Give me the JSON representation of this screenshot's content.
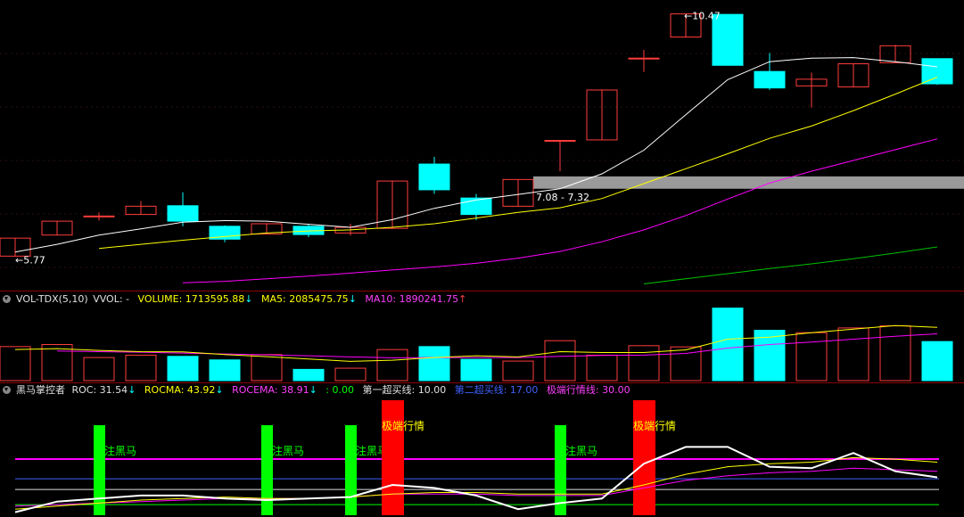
{
  "main_chart": {
    "high_label": "10.47",
    "low_label": "5.77",
    "price_band_label": "7.08 - 7.32"
  },
  "volume_header": {
    "indicator": "VOL-TDX(5,10)",
    "vol_text": "VVOL: -",
    "volume_label": "VOLUME: 1713595.88",
    "volume_arrow": "↓",
    "ma5_label": "MA5: 2085475.75",
    "ma5_arrow": "↓",
    "ma10_label": "MA10: 1890241.75",
    "ma10_arrow": "↑"
  },
  "indicator_header": {
    "name": "黑马掌控者",
    "roc_label": "ROC: 31.54",
    "roc_arrow": "↓",
    "rocma_label": "ROCMA: 43.92",
    "rocma_arrow": "↓",
    "rocema_label": "ROCEMA: 38.91",
    "rocema_arrow": "↓",
    "zero_label": ": 0.00",
    "line1_label": "第一超买线: 10.00",
    "line2_label": "第二超买线: 17.00",
    "line3_label": "极端行情线: 30.00"
  },
  "annotations": {
    "watch_dark_horse": "关注黑马",
    "extreme_market": "极端行情"
  },
  "colors": {
    "up": "#ff3c3c",
    "down": "#00ffff",
    "ma_white": "#ffffff",
    "ma_yellow": "#ffff00",
    "ma_magenta": "#ff00ff",
    "ma_green": "#00c000",
    "signal_green": "#00ff00",
    "signal_red": "#ff0000"
  },
  "chart_data": {
    "type": "candlestick",
    "candles": [
      {
        "o": 5.77,
        "h": 6.12,
        "l": 5.77,
        "c": 6.12
      },
      {
        "o": 6.18,
        "h": 6.45,
        "l": 6.18,
        "c": 6.45
      },
      {
        "o": 6.55,
        "h": 6.62,
        "l": 6.46,
        "c": 6.55
      },
      {
        "o": 6.58,
        "h": 6.84,
        "l": 6.58,
        "c": 6.74
      },
      {
        "o": 6.75,
        "h": 7.01,
        "l": 6.35,
        "c": 6.45
      },
      {
        "o": 6.35,
        "h": 6.37,
        "l": 6.04,
        "c": 6.1
      },
      {
        "o": 6.2,
        "h": 6.41,
        "l": 6.2,
        "c": 6.4
      },
      {
        "o": 6.35,
        "h": 6.4,
        "l": 6.14,
        "c": 6.19
      },
      {
        "o": 6.22,
        "h": 6.4,
        "l": 6.17,
        "c": 6.33
      },
      {
        "o": 6.31,
        "h": 7.23,
        "l": 6.31,
        "c": 7.23
      },
      {
        "o": 7.56,
        "h": 7.7,
        "l": 6.98,
        "c": 7.06
      },
      {
        "o": 6.9,
        "h": 6.98,
        "l": 6.47,
        "c": 6.58
      },
      {
        "o": 6.74,
        "h": 7.26,
        "l": 6.74,
        "c": 7.26
      },
      {
        "o": 8.02,
        "h": 8.02,
        "l": 7.42,
        "c": 8.02
      },
      {
        "o": 8.03,
        "h": 9.0,
        "l": 8.03,
        "c": 9.0
      },
      {
        "o": 9.62,
        "h": 9.78,
        "l": 9.35,
        "c": 9.62
      },
      {
        "o": 10.03,
        "h": 10.48,
        "l": 10.03,
        "c": 10.48
      },
      {
        "o": 10.47,
        "h": 10.47,
        "l": 9.48,
        "c": 9.48
      },
      {
        "o": 9.36,
        "h": 9.72,
        "l": 9.0,
        "c": 9.04
      },
      {
        "o": 9.08,
        "h": 9.34,
        "l": 8.66,
        "c": 9.21
      },
      {
        "o": 9.06,
        "h": 9.51,
        "l": 9.06,
        "c": 9.51
      },
      {
        "o": 9.53,
        "h": 9.88,
        "l": 9.53,
        "c": 9.86
      },
      {
        "o": 9.61,
        "h": 9.61,
        "l": 9.1,
        "c": 9.12
      }
    ],
    "ma_white": [
      5.85,
      6.0,
      6.18,
      6.3,
      6.43,
      6.46,
      6.45,
      6.39,
      6.33,
      6.48,
      6.7,
      6.86,
      6.97,
      7.08,
      7.37,
      7.83,
      8.52,
      9.2,
      9.55,
      9.62,
      9.63,
      9.55,
      9.45
    ],
    "ma_yellow": [
      null,
      null,
      5.92,
      6.0,
      6.08,
      6.15,
      6.22,
      6.26,
      6.28,
      6.33,
      6.4,
      6.51,
      6.62,
      6.71,
      6.89,
      7.18,
      7.47,
      7.76,
      8.06,
      8.3,
      8.6,
      8.92,
      9.25
    ],
    "ma_magenta": [
      null,
      null,
      null,
      null,
      5.25,
      5.28,
      5.33,
      5.38,
      5.44,
      5.5,
      5.56,
      5.63,
      5.73,
      5.86,
      6.05,
      6.28,
      6.56,
      6.88,
      7.19,
      7.42,
      7.63,
      7.84,
      8.05
    ],
    "ma_green": [
      null,
      null,
      null,
      null,
      null,
      null,
      null,
      null,
      null,
      null,
      null,
      null,
      null,
      null,
      null,
      5.23,
      5.33,
      5.43,
      5.53,
      5.62,
      5.72,
      5.83,
      5.95
    ],
    "volumes": [
      1.15,
      1.22,
      0.78,
      0.86,
      0.82,
      0.7,
      0.88,
      0.38,
      0.42,
      1.05,
      1.15,
      0.72,
      0.66,
      1.35,
      0.86,
      1.18,
      1.14,
      2.45,
      1.7,
      1.62,
      1.78,
      1.85,
      1.32
    ],
    "vol_ma5": [
      1.05,
      1.08,
      1.02,
      0.98,
      0.97,
      0.88,
      0.81,
      0.73,
      0.65,
      0.69,
      0.78,
      0.84,
      0.8,
      0.98,
      0.95,
      0.95,
      1.04,
      1.4,
      1.47,
      1.62,
      1.74,
      1.86,
      1.8
    ],
    "vol_ma10": [
      null,
      1.0,
      0.98,
      0.96,
      0.93,
      0.9,
      0.87,
      0.84,
      0.8,
      0.77,
      0.78,
      0.78,
      0.78,
      0.82,
      0.85,
      0.86,
      0.92,
      1.1,
      1.22,
      1.3,
      1.4,
      1.5,
      1.58
    ],
    "roc": [
      -5,
      2,
      4,
      6,
      6,
      4,
      3,
      4,
      5,
      13,
      11,
      6,
      -3,
      1,
      4,
      27,
      38,
      38,
      25,
      24,
      34,
      22,
      18
    ],
    "rocma": [
      -3,
      -1,
      1,
      3,
      4,
      5,
      4,
      4,
      5,
      7,
      8,
      8,
      7,
      7,
      7,
      13,
      20,
      25,
      27,
      28,
      31,
      30,
      28
    ],
    "rocema": [
      -1,
      0,
      1,
      2,
      3,
      4,
      4,
      4,
      5,
      7,
      7,
      7,
      6,
      6,
      6,
      11,
      16,
      19,
      21,
      22,
      24,
      23,
      22
    ],
    "overbought_lines": [
      0,
      10,
      17,
      30
    ],
    "green_signal_bars": [
      2,
      6,
      8,
      13
    ],
    "red_signal_bars": [
      9,
      15
    ],
    "main_ylim": [
      5.1,
      10.75
    ],
    "vol_ylim": [
      0,
      2.5
    ],
    "ind_ylim": [
      -7,
      70
    ]
  }
}
